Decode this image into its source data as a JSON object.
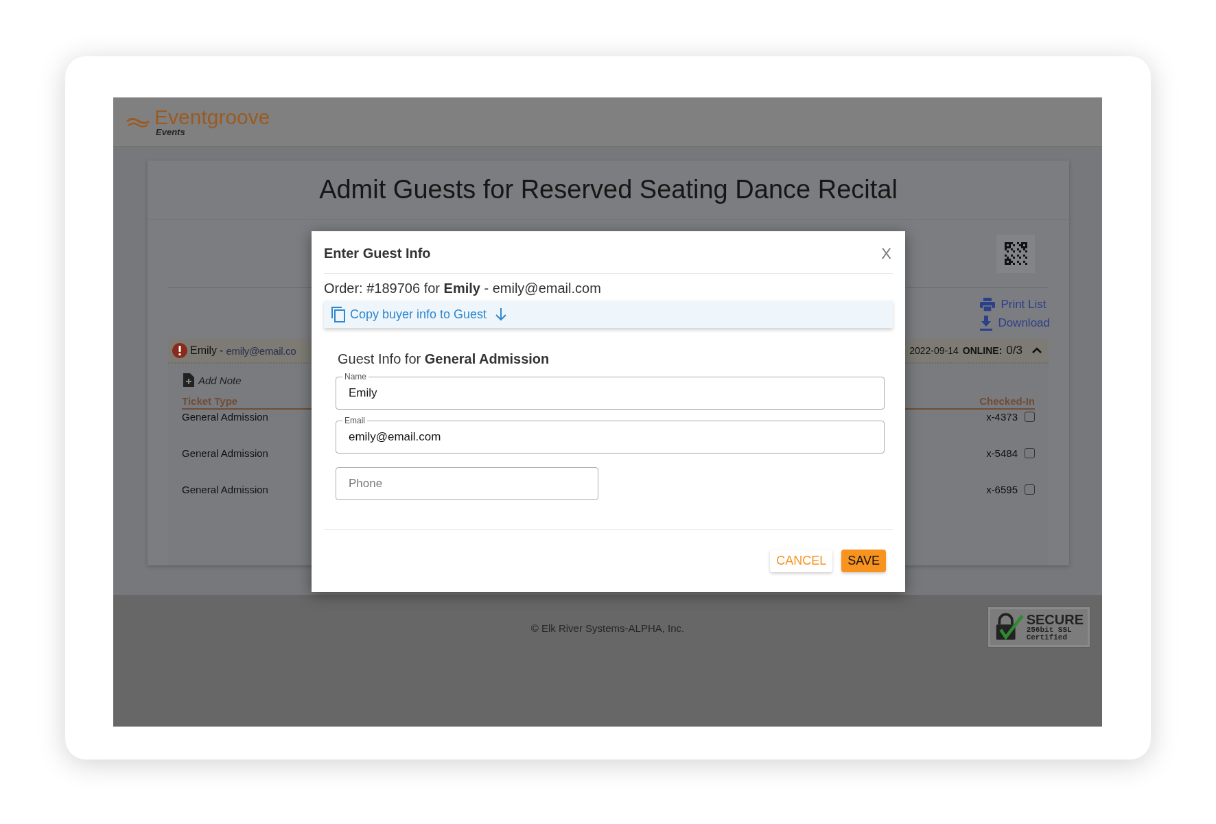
{
  "brand": {
    "name": "Eventgroove",
    "sub": "Events"
  },
  "page_title": "Admit Guests for Reserved Seating Dance Recital",
  "actions": [
    {
      "label": "Print List",
      "kind": "print"
    },
    {
      "label": "Download",
      "kind": "download"
    }
  ],
  "order_group": {
    "name": "Emily",
    "separator": "-",
    "email": "emily@email.co",
    "date": "2022-09-14",
    "online_label": "ONLINE:",
    "online_count": "0/3",
    "expanded": true,
    "add_note": "Add Note",
    "columns": [
      "Ticket Type",
      "Checked-In"
    ],
    "rows": [
      {
        "ticket_type": "General Admission",
        "code": "x-4373",
        "checked": false
      },
      {
        "ticket_type": "General Admission",
        "code": "x-5484",
        "checked": false
      },
      {
        "ticket_type": "General Admission",
        "code": "x-6595",
        "checked": false
      }
    ]
  },
  "footer": {
    "copyright": "© Elk River Systems-ALPHA, Inc.",
    "badge": {
      "title": "SECURE",
      "line1": "256bit SSL",
      "line2": "Certified"
    }
  },
  "modal": {
    "title": "Enter Guest Info",
    "close": "X",
    "order_line": "Order: #189706 for **Emily** - emily@email.com",
    "copy_link": "Copy buyer info to Guest",
    "section": "Guest Info for **General Admission**",
    "fields": [
      {
        "label": "Name",
        "value": "Emily"
      },
      {
        "label": "Email",
        "value": "emily@email.com"
      },
      {
        "placeholder": "Phone"
      }
    ],
    "buttons": [
      {
        "label": "CANCEL",
        "kind": "secondary"
      },
      {
        "label": "SAVE",
        "kind": "primary"
      }
    ]
  }
}
